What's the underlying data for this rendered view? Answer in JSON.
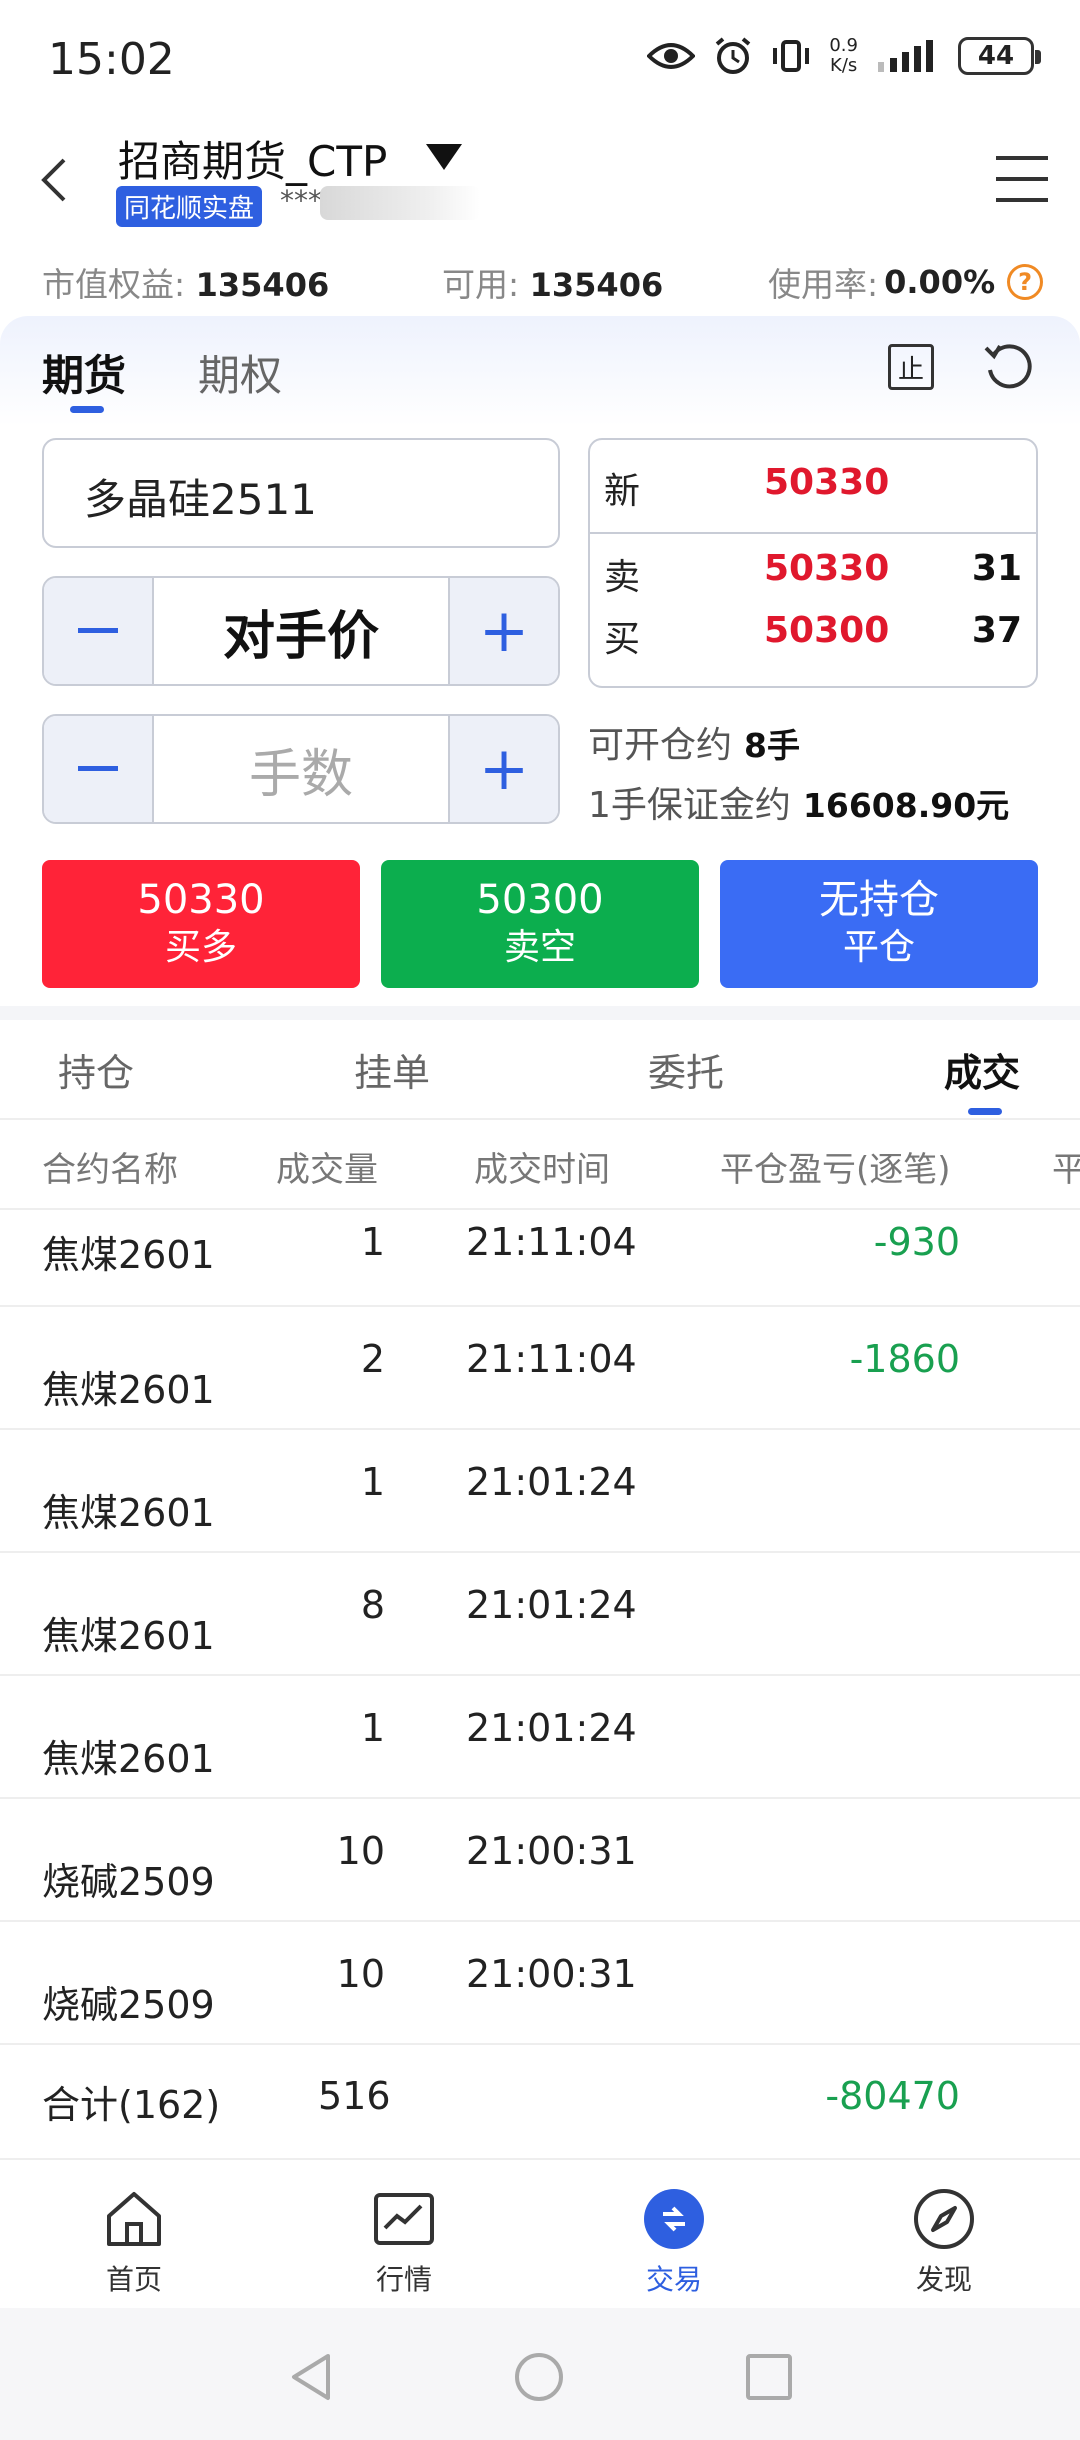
{
  "status_bar": {
    "time": "15:02",
    "net_speed_value": "0.9",
    "net_speed_unit": "K/s",
    "battery": "44",
    "icons": [
      "eye-icon",
      "alarm-icon",
      "vibrate-icon",
      "signal-icon",
      "battery-icon"
    ]
  },
  "header": {
    "account_title": "招商期货_CTP",
    "badge": "同花顺实盘",
    "account_mask": "***"
  },
  "summary": {
    "equity_label": "市值权益:",
    "equity_value": "135406",
    "available_label": "可用:",
    "available_value": "135406",
    "usage_label": "使用率:",
    "usage_value": "0.00%",
    "help": "?"
  },
  "trade": {
    "tabs": [
      "期货",
      "期权"
    ],
    "stop_label": "止",
    "contract": "多晶硅2511",
    "price_mode": "对手价",
    "qty_placeholder": "手数",
    "minus": "—",
    "plus": "+",
    "quote": {
      "last_label": "新",
      "last_price": "50330",
      "ask_label": "卖",
      "ask_price": "50330",
      "ask_vol": "31",
      "bid_label": "买",
      "bid_price": "50300",
      "bid_vol": "37"
    },
    "openable_label": "可开仓约",
    "openable_value": "8手",
    "margin_label": "1手保证金约",
    "margin_value": "16608.90元",
    "buy_price": "50330",
    "buy_label": "买多",
    "sell_price": "50300",
    "sell_label": "卖空",
    "close_top": "无持仓",
    "close_label": "平仓",
    "colors": {
      "buy": "#ff2338",
      "sell": "#0cae4e",
      "close": "#3a6cf4",
      "accent": "#2e5fe0"
    }
  },
  "records": {
    "tabs": [
      "持仓",
      "挂单",
      "委托",
      "成交"
    ],
    "active_tab": "成交",
    "columns": [
      "合约名称",
      "成交量",
      "成交时间",
      "平仓盈亏(逐笔)",
      "平"
    ],
    "rows": [
      {
        "name": "焦煤2601",
        "qty": "1",
        "time": "21:11:04",
        "pnl": "-930"
      },
      {
        "name": "焦煤2601",
        "qty": "2",
        "time": "21:11:04",
        "pnl": "-1860"
      },
      {
        "name": "焦煤2601",
        "qty": "1",
        "time": "21:01:24",
        "pnl": ""
      },
      {
        "name": "焦煤2601",
        "qty": "8",
        "time": "21:01:24",
        "pnl": ""
      },
      {
        "name": "焦煤2601",
        "qty": "1",
        "time": "21:01:24",
        "pnl": ""
      },
      {
        "name": "烧碱2509",
        "qty": "10",
        "time": "21:00:31",
        "pnl": ""
      },
      {
        "name": "烧碱2509",
        "qty": "10",
        "time": "21:00:31",
        "pnl": ""
      }
    ],
    "total_label": "合计(162)",
    "total_qty": "516",
    "total_pnl": "-80470"
  },
  "bottom_nav": [
    {
      "label": "首页",
      "icon": "home-icon"
    },
    {
      "label": "行情",
      "icon": "chart-icon"
    },
    {
      "label": "交易",
      "icon": "trade-icon"
    },
    {
      "label": "发现",
      "icon": "compass-icon"
    }
  ]
}
